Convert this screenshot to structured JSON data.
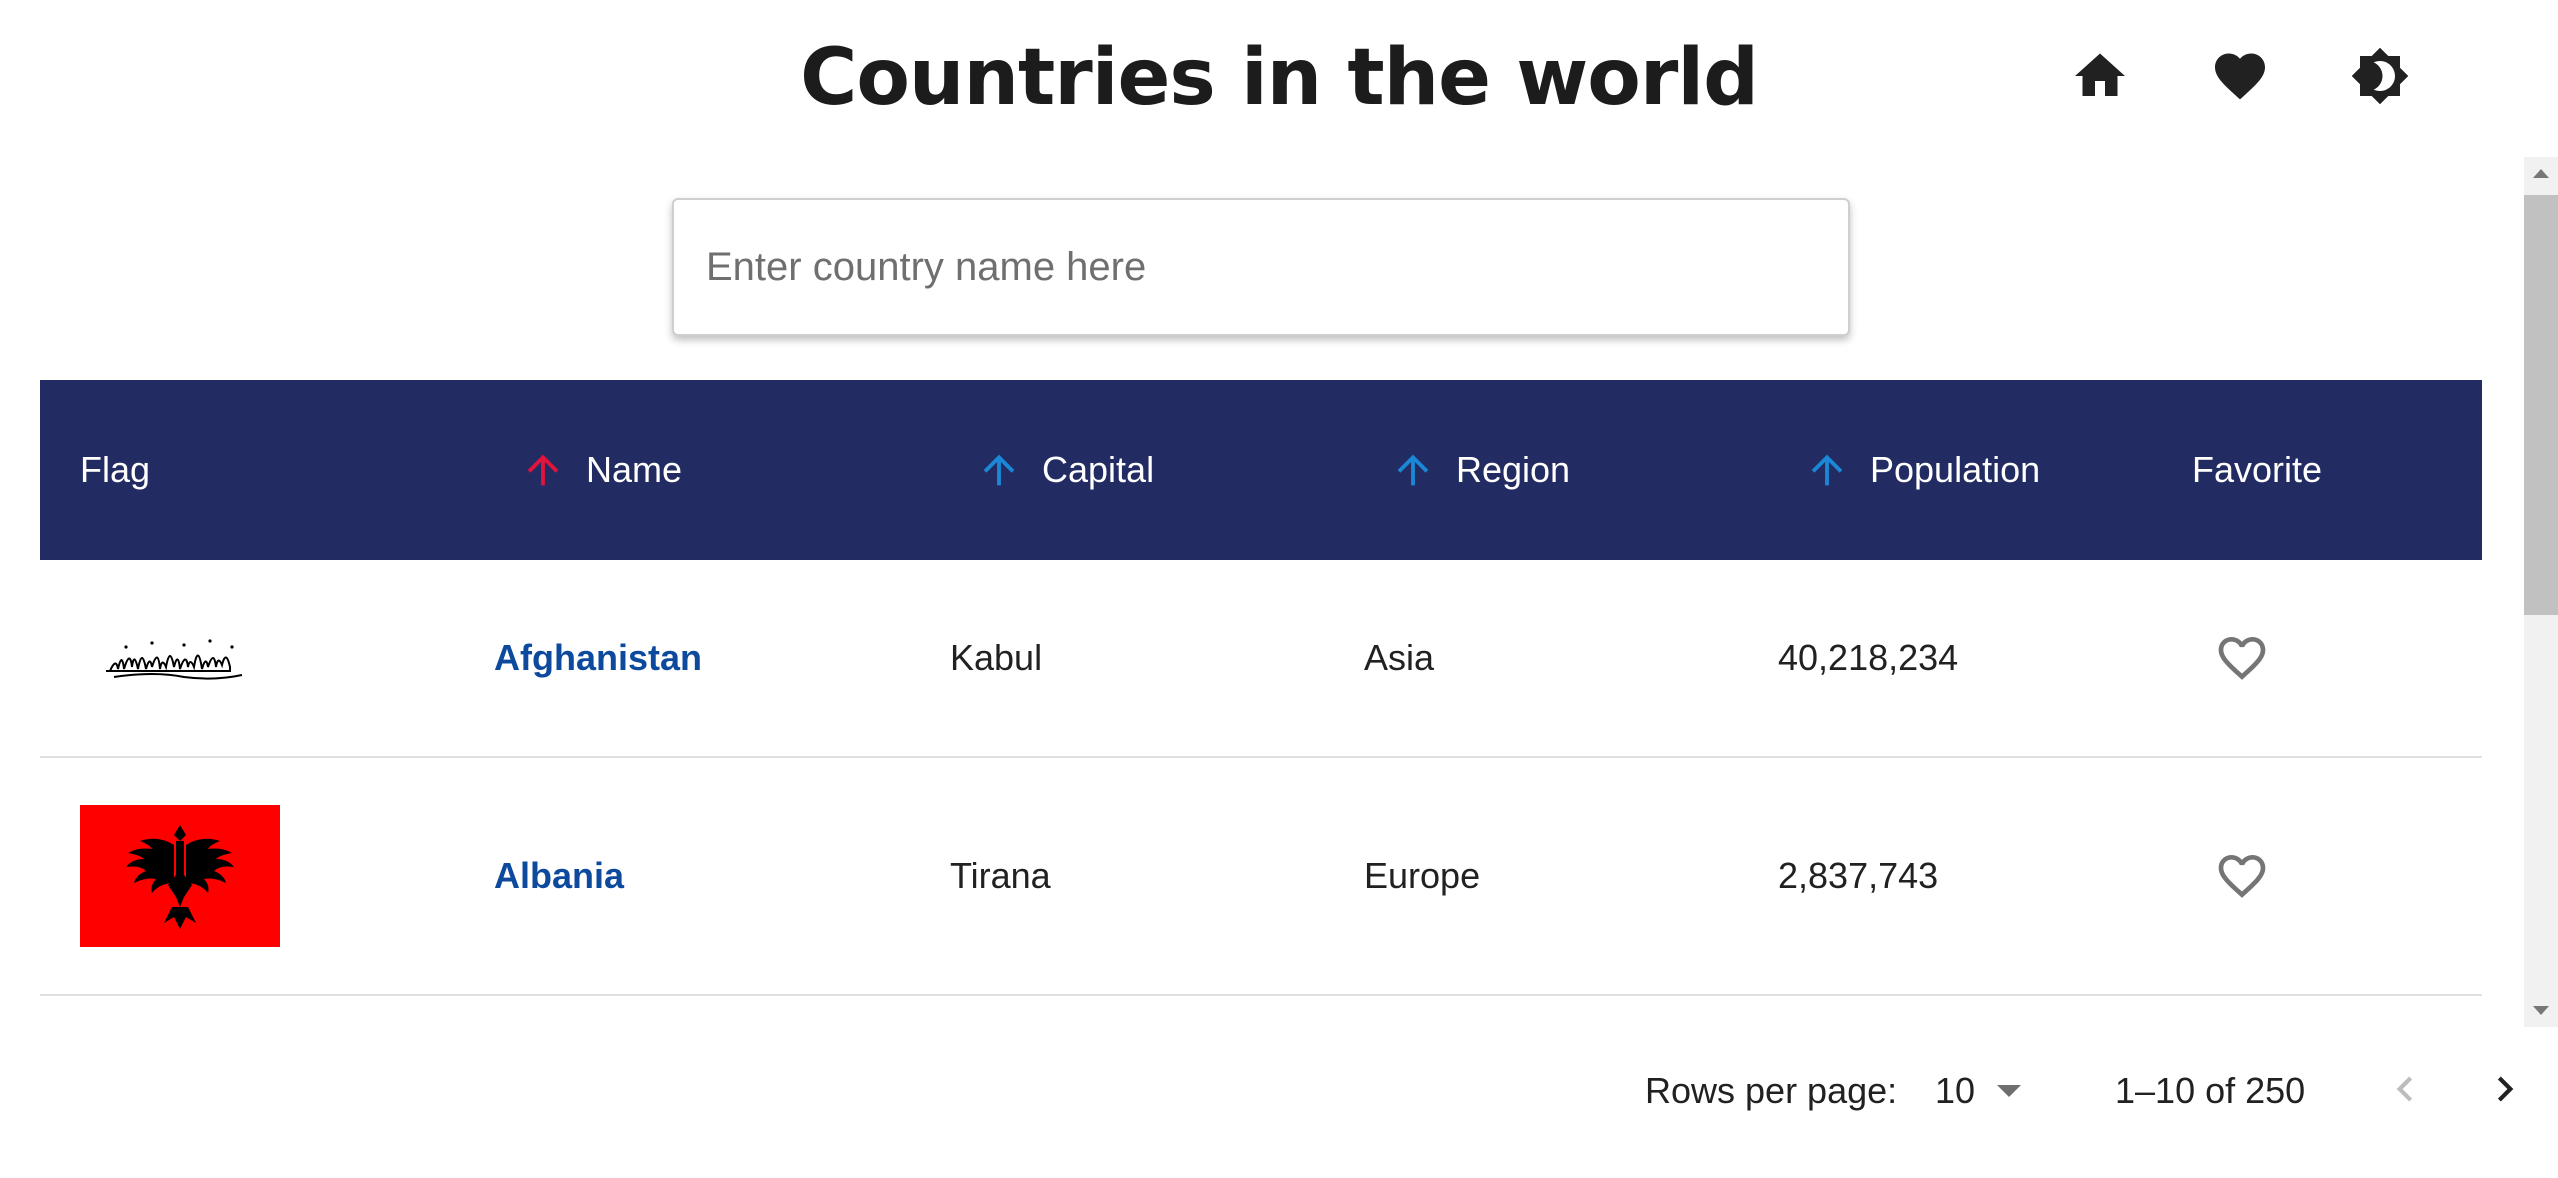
{
  "header": {
    "title": "Countries in the world",
    "icons": [
      "home-icon",
      "heart-icon",
      "brightness-icon"
    ]
  },
  "search": {
    "placeholder": "Enter country name here",
    "value": ""
  },
  "table": {
    "columns": [
      {
        "label": "Flag",
        "sortable": false
      },
      {
        "label": "Name",
        "sortable": true,
        "active": true,
        "arrow_color": "#e0143c"
      },
      {
        "label": "Capital",
        "sortable": true,
        "arrow_color": "#1a88d6"
      },
      {
        "label": "Region",
        "sortable": true,
        "arrow_color": "#1a88d6"
      },
      {
        "label": "Population",
        "sortable": true,
        "arrow_color": "#1a88d6"
      },
      {
        "label": "Favorite",
        "sortable": false
      }
    ],
    "rows": [
      {
        "flag": "afghanistan-flag",
        "name": "Afghanistan",
        "capital": "Kabul",
        "region": "Asia",
        "population": "40,218,234",
        "favorite": false
      },
      {
        "flag": "albania-flag",
        "name": "Albania",
        "capital": "Tirana",
        "region": "Europe",
        "population": "2,837,743",
        "favorite": false
      }
    ]
  },
  "pagination": {
    "rows_per_page_label": "Rows per page:",
    "rows_per_page": "10",
    "range": "1–10 of 250"
  },
  "colors": {
    "header_bg": "#232c62",
    "link": "#0d4a9e",
    "albania_red": "#ff0000"
  }
}
